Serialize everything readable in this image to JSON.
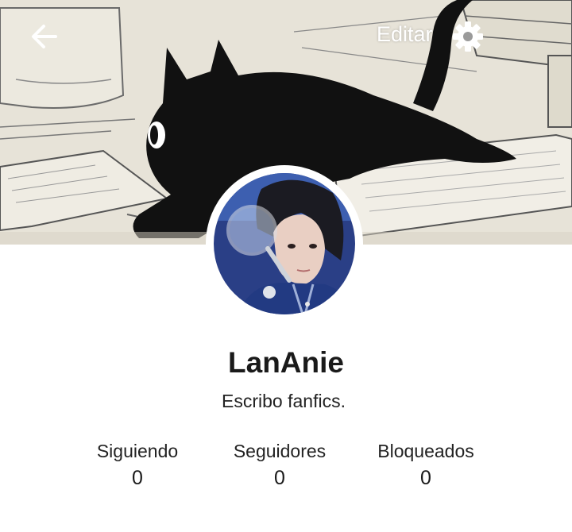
{
  "header": {
    "back_icon": "arrow-left-icon",
    "edit_label": "Editar",
    "settings_icon": "gear-icon"
  },
  "profile": {
    "username": "LanAnie",
    "bio": "Escribo fanfics."
  },
  "stats": [
    {
      "label": "Siguiendo",
      "value": "0"
    },
    {
      "label": "Seguidores",
      "value": "0"
    },
    {
      "label": "Bloqueados",
      "value": "0"
    }
  ],
  "colors": {
    "banner_paper": "#e6e2d6",
    "cat": "#111111",
    "text": "#1a1a1a",
    "avatar_blue": "#27418a"
  }
}
